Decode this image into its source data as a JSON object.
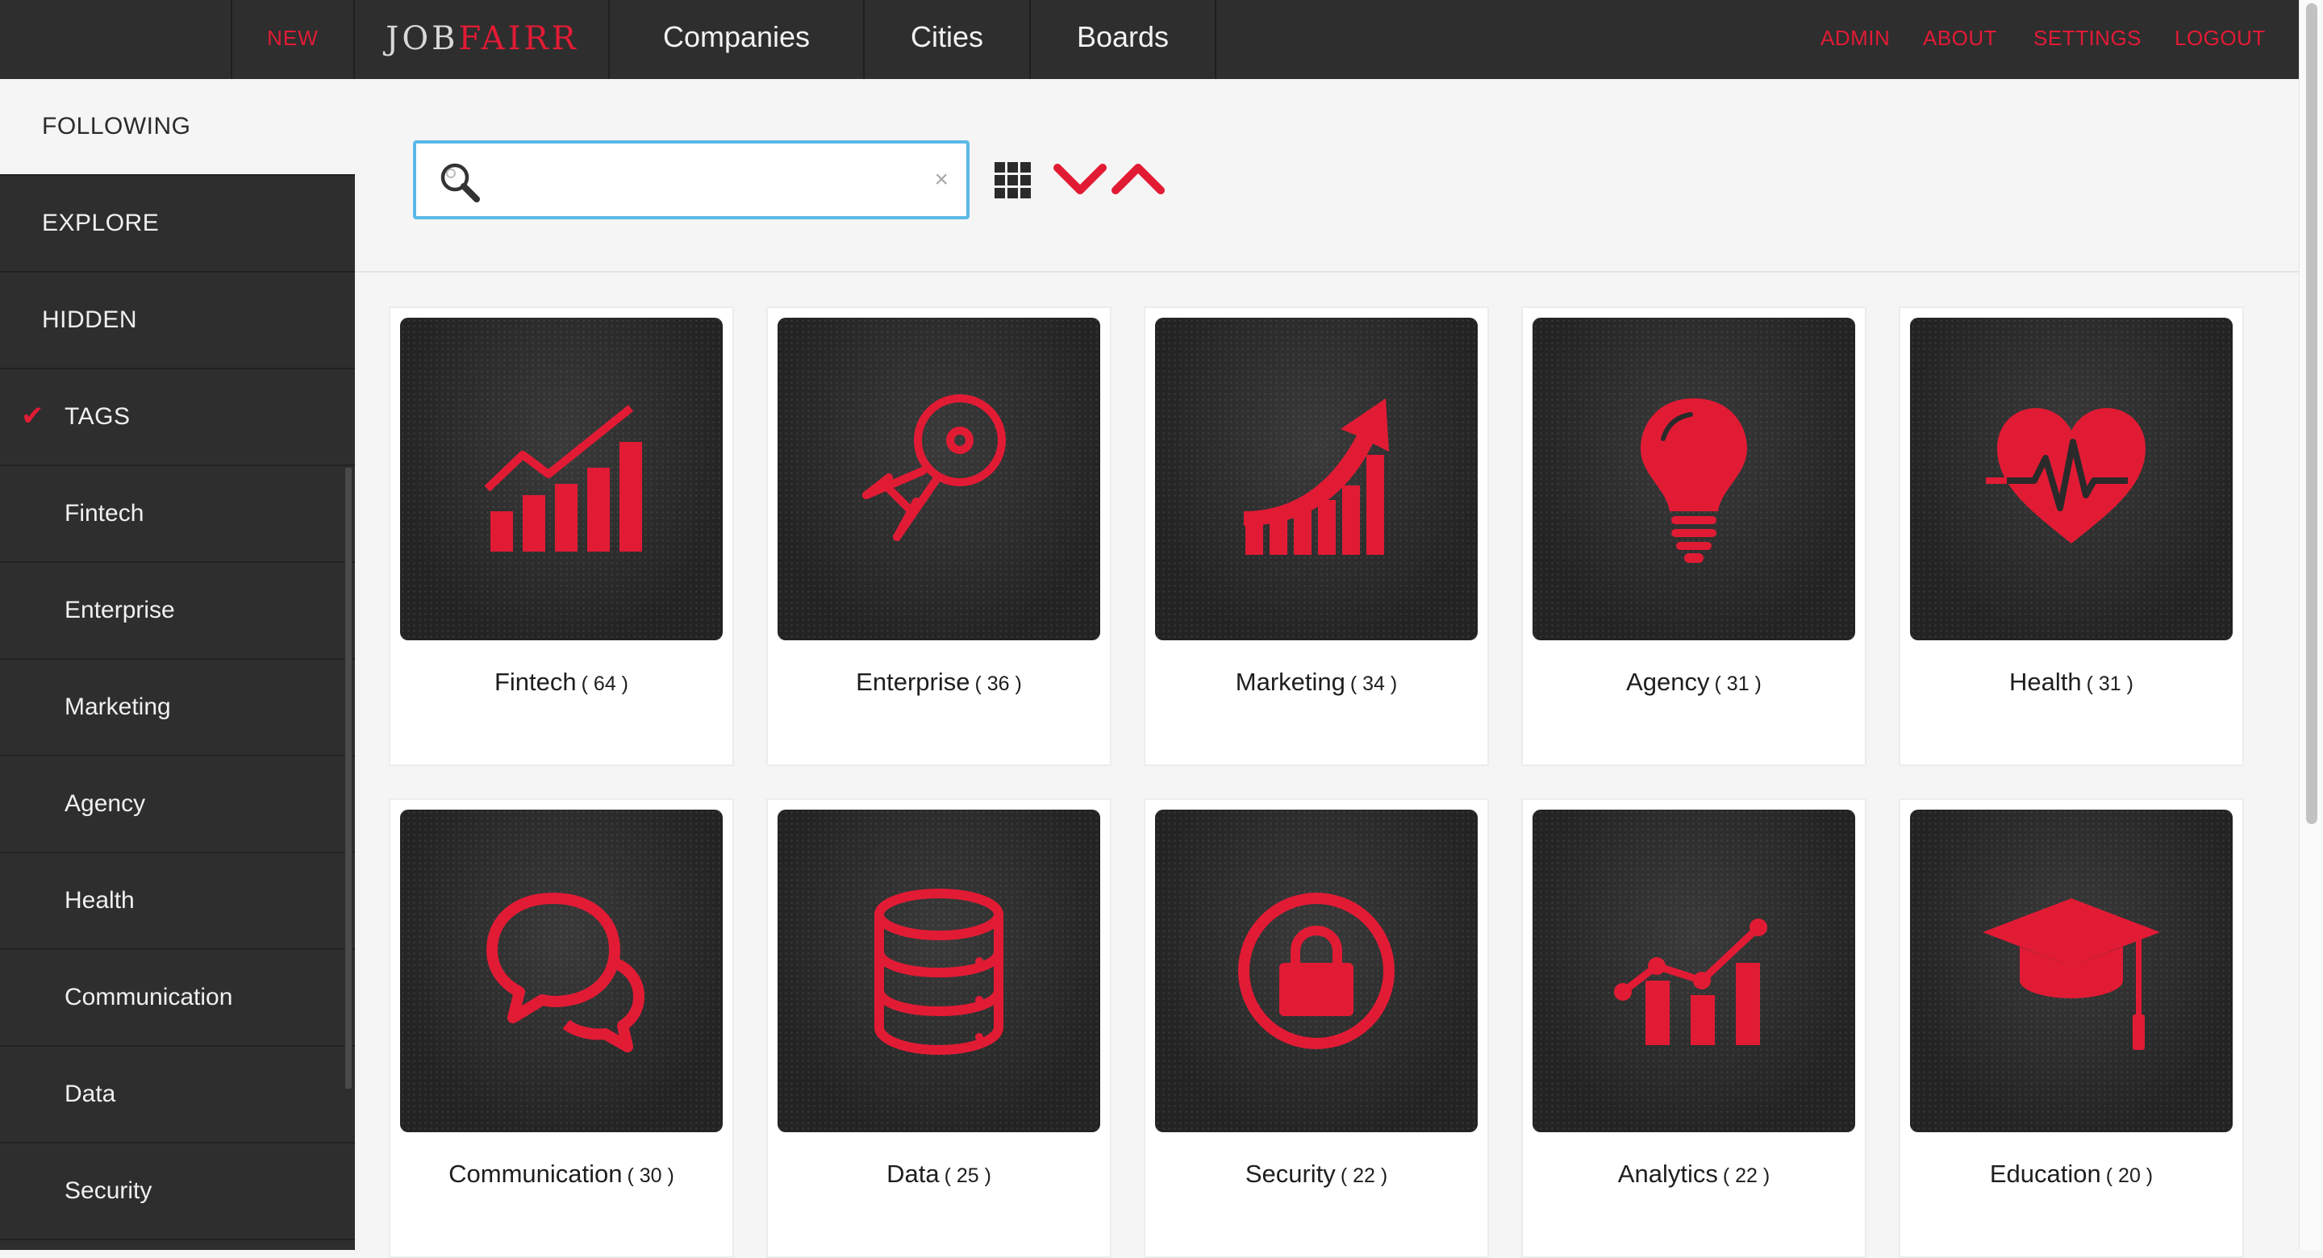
{
  "topbar": {
    "new_label": "NEW",
    "logo_part1": "JOB",
    "logo_part2": "FAIRR",
    "nav": [
      {
        "label": "Companies"
      },
      {
        "label": "Cities"
      },
      {
        "label": "Boards"
      }
    ],
    "right_links": [
      {
        "label": "ADMIN"
      },
      {
        "label": "ABOUT"
      },
      {
        "label": "SETTINGS"
      },
      {
        "label": "LOGOUT"
      }
    ]
  },
  "sidebar": {
    "items": [
      {
        "label": "FOLLOWING"
      },
      {
        "label": "EXPLORE"
      },
      {
        "label": "HIDDEN"
      },
      {
        "label": "TAGS",
        "checked": true
      },
      {
        "label": "Fintech"
      },
      {
        "label": "Enterprise"
      },
      {
        "label": "Marketing"
      },
      {
        "label": "Agency"
      },
      {
        "label": "Health"
      },
      {
        "label": "Communication"
      },
      {
        "label": "Data"
      },
      {
        "label": "Security"
      }
    ]
  },
  "toolbar": {
    "search_placeholder": "",
    "search_value": "",
    "clear_glyph": "×",
    "icons": [
      "search-icon",
      "grid-view-icon",
      "sort-descending-icon",
      "sort-ascending-icon"
    ]
  },
  "cards": [
    {
      "name": "Fintech",
      "count": "( 64 )",
      "icon": "bar-chart-trend-icon"
    },
    {
      "name": "Enterprise",
      "count": "( 36 )",
      "icon": "spaceship-icon"
    },
    {
      "name": "Marketing",
      "count": "( 34 )",
      "icon": "growth-arrow-icon"
    },
    {
      "name": "Agency",
      "count": "( 31 )",
      "icon": "lightbulb-icon"
    },
    {
      "name": "Health",
      "count": "( 31 )",
      "icon": "heartbeat-icon"
    },
    {
      "name": "Communication",
      "count": "( 30 )",
      "icon": "chat-bubbles-icon"
    },
    {
      "name": "Data",
      "count": "( 25 )",
      "icon": "database-icon"
    },
    {
      "name": "Security",
      "count": "( 22 )",
      "icon": "lock-icon"
    },
    {
      "name": "Analytics",
      "count": "( 22 )",
      "icon": "analytics-chart-icon"
    },
    {
      "name": "Education",
      "count": "( 20 )",
      "icon": "graduation-cap-icon"
    }
  ],
  "colors": {
    "accent": "#e21b35",
    "topbar_bg": "#2e2e2e",
    "sidebar_bg": "#2e2e2e",
    "search_border": "#5bb8e6",
    "page_bg": "#f5f5f5"
  }
}
